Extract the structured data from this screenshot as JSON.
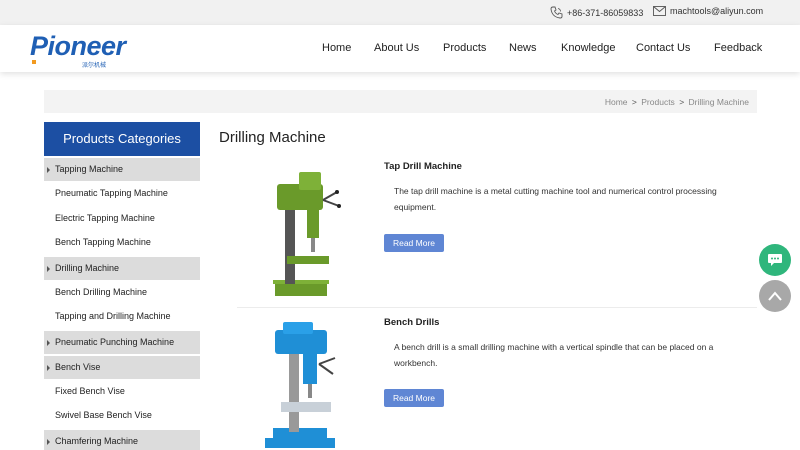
{
  "contact": {
    "phone": "+86-371-86059833",
    "email": "machtools@aliyun.com"
  },
  "logo": {
    "text": "Pioneer",
    "subtitle": "派尔机械"
  },
  "nav": {
    "items": [
      "Home",
      "About Us",
      "Products",
      "News",
      "Knowledge",
      "Contact Us",
      "Feedback"
    ]
  },
  "breadcrumb": {
    "home": "Home",
    "products": "Products",
    "current": "Drilling Machine",
    "separator": ">"
  },
  "sidebar": {
    "title": "Products Categories",
    "items": [
      {
        "label": "Tapping Machine",
        "type": "main"
      },
      {
        "label": "Pneumatic Tapping Machine",
        "type": "sub"
      },
      {
        "label": "Electric Tapping Machine",
        "type": "sub"
      },
      {
        "label": "Bench Tapping Machine",
        "type": "sub"
      },
      {
        "label": "Drilling Machine",
        "type": "main"
      },
      {
        "label": "Bench Drilling Machine",
        "type": "sub"
      },
      {
        "label": "Tapping and Drilling Machine",
        "type": "sub"
      },
      {
        "label": "Pneumatic Punching Machine",
        "type": "main"
      },
      {
        "label": "Bench Vise",
        "type": "main"
      },
      {
        "label": "Fixed Bench Vise",
        "type": "sub"
      },
      {
        "label": "Swivel Base Bench Vise",
        "type": "sub"
      },
      {
        "label": "Chamfering Machine",
        "type": "main"
      }
    ]
  },
  "main": {
    "title": "Drilling Machine",
    "products": [
      {
        "name": "Tap Drill Machine",
        "description": "The tap drill machine is a metal cutting machine tool and numerical control processing equipment.",
        "button": "Read More",
        "color": "#6a9a2a"
      },
      {
        "name": "Bench Drills",
        "description": "A bench drill is a small drilling machine with a vertical spindle that can be placed on a workbench.",
        "button": "Read More",
        "color": "#1f8fd6"
      }
    ]
  },
  "colors": {
    "brand_blue": "#1c4fa3",
    "button_blue": "#5f86d4",
    "chat_green": "#2fb67c"
  }
}
